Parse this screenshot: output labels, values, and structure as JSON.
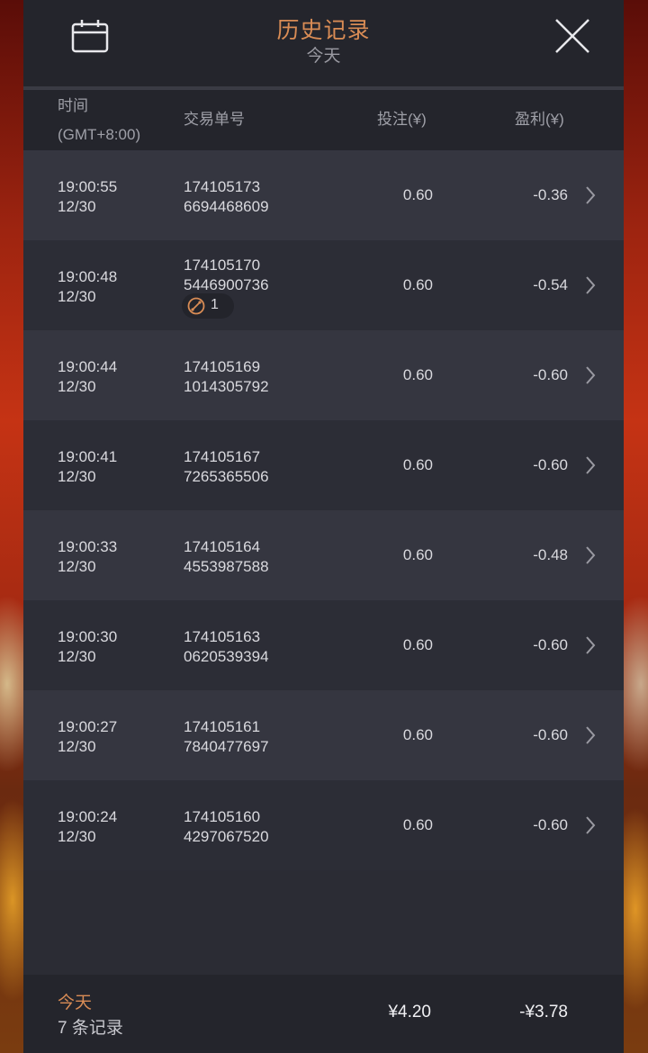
{
  "header": {
    "title": "历史记录",
    "subtitle": "今天",
    "calendar_icon": "calendar-icon",
    "close_icon": "close-icon"
  },
  "columns": {
    "time_line1": "时间",
    "time_line2": "(GMT+8:00)",
    "order": "交易单号",
    "bet": "投注(¥)",
    "profit": "盈利(¥)"
  },
  "rows": [
    {
      "time": "19:00:55",
      "date": "12/30",
      "order1": "174105173",
      "order2": "6694468609",
      "bet": "0.60",
      "profit": "-0.36"
    },
    {
      "time": "19:00:48",
      "date": "12/30",
      "order1": "174105170",
      "order2": "5446900736",
      "bet": "0.60",
      "profit": "-0.54",
      "badge_icon": "compass-icon",
      "badge_count": "1"
    },
    {
      "time": "19:00:44",
      "date": "12/30",
      "order1": "174105169",
      "order2": "1014305792",
      "bet": "0.60",
      "profit": "-0.60"
    },
    {
      "time": "19:00:41",
      "date": "12/30",
      "order1": "174105167",
      "order2": "7265365506",
      "bet": "0.60",
      "profit": "-0.60"
    },
    {
      "time": "19:00:33",
      "date": "12/30",
      "order1": "174105164",
      "order2": "4553987588",
      "bet": "0.60",
      "profit": "-0.48"
    },
    {
      "time": "19:00:30",
      "date": "12/30",
      "order1": "174105163",
      "order2": "0620539394",
      "bet": "0.60",
      "profit": "-0.60"
    },
    {
      "time": "19:00:27",
      "date": "12/30",
      "order1": "174105161",
      "order2": "7840477697",
      "bet": "0.60",
      "profit": "-0.60"
    },
    {
      "time": "19:00:24",
      "date": "12/30",
      "order1": "174105160",
      "order2": "4297067520",
      "bet": "0.60",
      "profit": "-0.60"
    }
  ],
  "footer": {
    "period": "今天",
    "count": "7 条记录",
    "total_bet": "¥4.20",
    "total_profit": "-¥3.78"
  },
  "colors": {
    "accent": "#d98c55",
    "panel": "#2b2c34",
    "header": "#24252c"
  }
}
